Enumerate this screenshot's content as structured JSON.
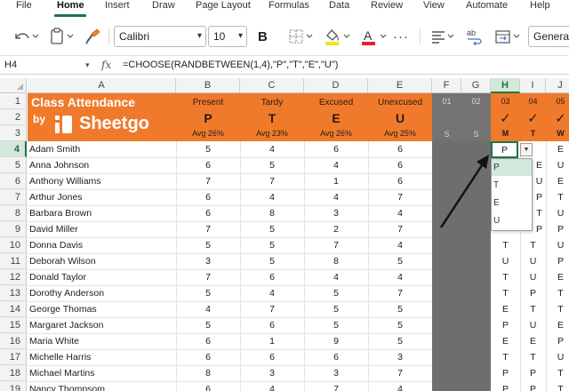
{
  "menu": {
    "items": [
      "File",
      "Home",
      "Insert",
      "Draw",
      "Page Layout",
      "Formulas",
      "Data",
      "Review",
      "View",
      "Automate",
      "Help"
    ],
    "active": "Home"
  },
  "toolbar": {
    "font_name": "Calibri",
    "font_size": "10",
    "bold_label": "B",
    "number_format": "General",
    "highlight_color": "#f5e416",
    "font_color": "#e0242a"
  },
  "formula_bar": {
    "name_box": "H4",
    "fx_label": "fx",
    "formula": "=CHOOSE(RANDBETWEEN(1,4),\"P\",\"T\",\"E\",\"U\")"
  },
  "columns": [
    "A",
    "B",
    "C",
    "D",
    "E",
    "F",
    "G",
    "H",
    "I",
    "J"
  ],
  "selected_column": "H",
  "rows": [
    "1",
    "2",
    "3",
    "4",
    "5",
    "6",
    "7",
    "8",
    "9",
    "10",
    "11",
    "12",
    "13",
    "14",
    "15",
    "16",
    "17",
    "18",
    "19"
  ],
  "selected_row": "4",
  "banner": {
    "title_line1": "Class Attendance",
    "title_by": "by",
    "brand": "Sheetgo",
    "brand_color": "#f07a2c",
    "categories": [
      {
        "label": "Present",
        "letter": "P",
        "avg": "Avg 26%"
      },
      {
        "label": "Tardy",
        "letter": "T",
        "avg": "Avg 23%"
      },
      {
        "label": "Excused",
        "letter": "E",
        "avg": "Avg 26%"
      },
      {
        "label": "Unexcused",
        "letter": "U",
        "avg": "Avg 25%"
      }
    ],
    "dark_days": [
      {
        "day": "01",
        "dow": "S"
      },
      {
        "day": "02",
        "dow": "S"
      }
    ],
    "days": [
      {
        "day": "03",
        "check": "✓",
        "dow": "M"
      },
      {
        "day": "04",
        "check": "✓",
        "dow": "T"
      },
      {
        "day": "05",
        "check": "✓",
        "dow": "W"
      }
    ]
  },
  "students": [
    {
      "name": "Adam Smith",
      "p": "5",
      "t": "4",
      "e": "6",
      "u": "6",
      "h": "P",
      "i": "",
      "j": "E"
    },
    {
      "name": "Anna Johnson",
      "p": "6",
      "t": "5",
      "e": "4",
      "u": "6",
      "h": "",
      "i": "E",
      "j": "U"
    },
    {
      "name": "Anthony Williams",
      "p": "7",
      "t": "7",
      "e": "1",
      "u": "6",
      "h": "",
      "i": "U",
      "j": "E"
    },
    {
      "name": "Arthur Jones",
      "p": "6",
      "t": "4",
      "e": "4",
      "u": "7",
      "h": "",
      "i": "P",
      "j": "T"
    },
    {
      "name": "Barbara Brown",
      "p": "6",
      "t": "8",
      "e": "3",
      "u": "4",
      "h": "",
      "i": "T",
      "j": "U"
    },
    {
      "name": "David Miller",
      "p": "7",
      "t": "5",
      "e": "2",
      "u": "7",
      "h": "",
      "i": "P",
      "j": "P"
    },
    {
      "name": "Donna Davis",
      "p": "5",
      "t": "5",
      "e": "7",
      "u": "4",
      "h": "T",
      "i": "T",
      "j": "U"
    },
    {
      "name": "Deborah Wilson",
      "p": "3",
      "t": "5",
      "e": "8",
      "u": "5",
      "h": "U",
      "i": "U",
      "j": "P"
    },
    {
      "name": "Donald Taylor",
      "p": "7",
      "t": "6",
      "e": "4",
      "u": "4",
      "h": "T",
      "i": "U",
      "j": "E"
    },
    {
      "name": "Dorothy Anderson",
      "p": "5",
      "t": "4",
      "e": "5",
      "u": "7",
      "h": "T",
      "i": "P",
      "j": "T"
    },
    {
      "name": "George Thomas",
      "p": "4",
      "t": "7",
      "e": "5",
      "u": "5",
      "h": "E",
      "i": "T",
      "j": "T"
    },
    {
      "name": "Margaret Jackson",
      "p": "5",
      "t": "6",
      "e": "5",
      "u": "5",
      "h": "P",
      "i": "U",
      "j": "E"
    },
    {
      "name": "Maria White",
      "p": "6",
      "t": "1",
      "e": "9",
      "u": "5",
      "h": "E",
      "i": "E",
      "j": "P"
    },
    {
      "name": "Michelle Harris",
      "p": "6",
      "t": "6",
      "e": "6",
      "u": "3",
      "h": "T",
      "i": "T",
      "j": "U"
    },
    {
      "name": "Michael Martins",
      "p": "8",
      "t": "3",
      "e": "3",
      "u": "7",
      "h": "P",
      "i": "P",
      "j": "T"
    },
    {
      "name": "Nancy Thompsom",
      "p": "6",
      "t": "4",
      "e": "7",
      "u": "4",
      "h": "P",
      "i": "P",
      "j": "T"
    }
  ],
  "dropdown": {
    "options": [
      "P",
      "T",
      "E",
      "U"
    ],
    "highlighted": "P"
  },
  "colors": {
    "accent_green": "#217346",
    "selection_tint": "#d3e7da",
    "banner_orange": "#f07a2c"
  }
}
